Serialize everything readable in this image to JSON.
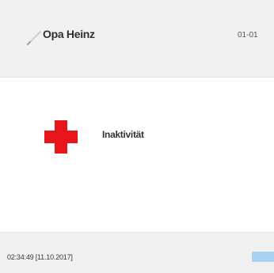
{
  "header": {
    "name": "Opa Heinz",
    "room": "01-01",
    "edit_icon": "pencil-icon"
  },
  "status": {
    "icon": "red-cross-icon",
    "label": "Inaktivität",
    "icon_color": "#e8141c"
  },
  "footer": {
    "timestamp": "02:34:49 [11.10.2017]",
    "button_color": "#a8d4f2"
  }
}
